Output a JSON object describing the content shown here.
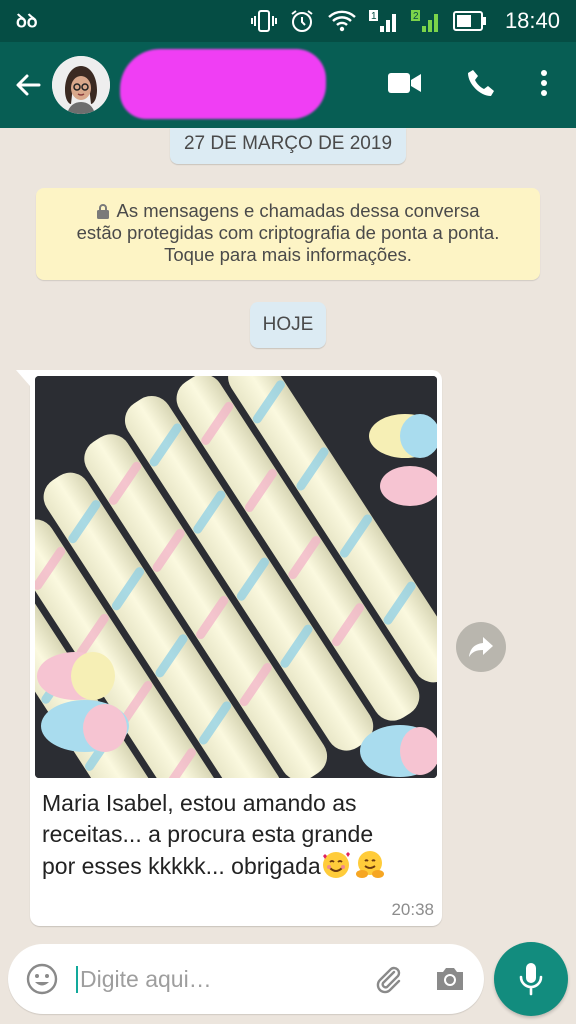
{
  "status_bar": {
    "left_icon": "ꝺꝺ",
    "time": "18:40",
    "sim1": "1",
    "sim2": "2",
    "icons": [
      "vibrate-icon",
      "alarm-icon",
      "wifi-icon",
      "signal-icon",
      "signal-icon",
      "battery-icon"
    ]
  },
  "header": {
    "back_icon": "arrow-left-icon",
    "avatar_icon": "avatar",
    "actions": [
      "video-call-icon",
      "phone-icon",
      "more-vert-icon"
    ],
    "accent": "#075e54"
  },
  "chat": {
    "date_chip": "27 DE MARÇO DE 2019",
    "security_notice": {
      "line1": "As mensagens e chamadas dessa conversa",
      "line2": "estão protegidas com criptografia de ponta a ponta.",
      "line3": "Toque para mais informações."
    },
    "today_chip": "HOJE",
    "message": {
      "caption_line1": "Maria Isabel, estou amando as",
      "caption_line2": "receitas... a procura esta grande",
      "caption_line3": "por esses kkkkk... obrigada",
      "time": "20:38",
      "emojis": [
        "smiling-face-with-hearts",
        "hugging-face"
      ]
    }
  },
  "input": {
    "placeholder": "Digite aqui…",
    "value": ""
  },
  "colors": {
    "status_bar": "#054d44",
    "app_bar": "#075e54",
    "chat_background": "#ece5dd",
    "mic_button": "#128c7e",
    "date_chip": "#dcebf3",
    "security_notice": "#fdf4c5"
  }
}
